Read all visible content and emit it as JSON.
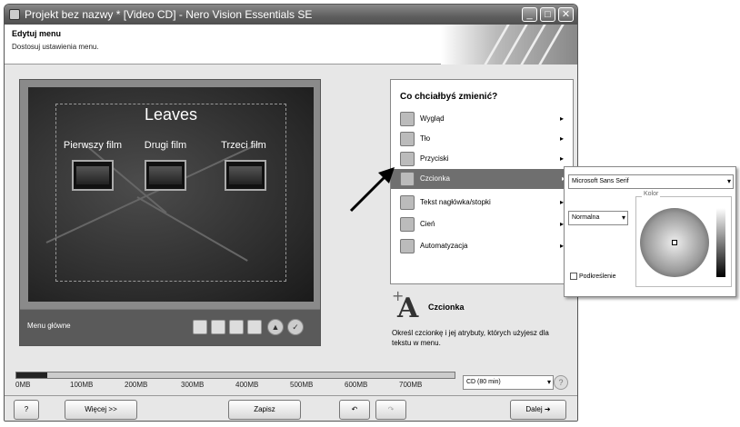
{
  "window": {
    "title": "Projekt bez nazwy * [Video CD] - Nero Vision Essentials SE",
    "minimize_icon": "minimize-icon",
    "maximize_icon": "maximize-icon",
    "close_icon": "close-icon"
  },
  "header": {
    "title": "Edytuj menu",
    "subtitle": "Dostosuj ustawienia menu."
  },
  "preview": {
    "menu_title": "Leaves",
    "films": [
      "Pierwszy film",
      "Drugi film",
      "Trzeci film"
    ],
    "bar_label": "Menu główne"
  },
  "panel": {
    "title": "Co chciałbyś zmienić?",
    "items": [
      {
        "label": "Wygląd",
        "icon": "layout-icon"
      },
      {
        "label": "Tło",
        "icon": "background-icon"
      },
      {
        "label": "Przyciski",
        "icon": "buttons-icon"
      },
      {
        "label": "Czcionka",
        "icon": "font-icon"
      },
      {
        "label": "Tekst nagłówka/stopki",
        "icon": "header-text-icon"
      },
      {
        "label": "Cień",
        "icon": "shadow-icon"
      },
      {
        "label": "Automatyzacja",
        "icon": "automation-icon"
      }
    ],
    "selected_index": 3
  },
  "info": {
    "title": "Czcionka",
    "description": "Określ czcionkę i jej atrybuty, których użyjesz dla tekstu w menu."
  },
  "font_flyout": {
    "font_name": "Microsoft Sans Serif",
    "style": "Normalna",
    "color_label": "Kolor",
    "underline_label": "Podkreślenie"
  },
  "capacity": {
    "ticks": [
      "0MB",
      "100MB",
      "200MB",
      "300MB",
      "400MB",
      "500MB",
      "600MB",
      "700MB"
    ],
    "used_fraction": 0.07,
    "disc": "CD (80 min)"
  },
  "bottom": {
    "more_label": "Więcej >>",
    "save_label": "Zapisz",
    "next_label": "Dalej"
  }
}
